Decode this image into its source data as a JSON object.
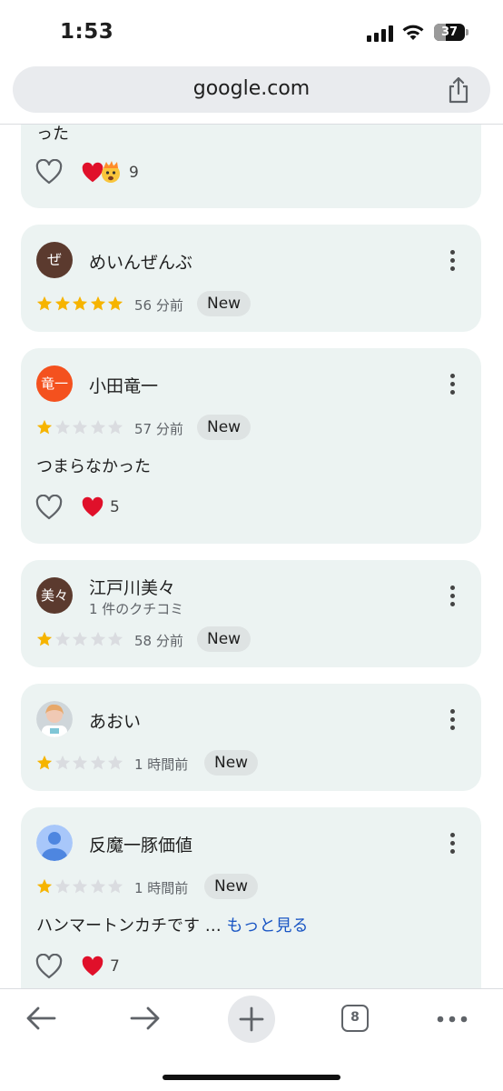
{
  "status": {
    "time": "1:53",
    "battery": "37",
    "battery_level": 0.37
  },
  "browser": {
    "url": "google.com",
    "tab_count": "8"
  },
  "reviews": [
    {
      "partial": true,
      "text": "った",
      "reaction_emojis": [
        "heart",
        "exploding-head"
      ],
      "reaction_count": "9"
    },
    {
      "avatar_text": "ぜ",
      "avatar_color": "#5b3a2e",
      "name": "めいんぜんぶ",
      "rating": 5,
      "age": "56 分前",
      "badge": "New"
    },
    {
      "avatar_text": "竜一",
      "avatar_color": "#f4511e",
      "name": "小田竜一",
      "rating": 1,
      "age": "57 分前",
      "badge": "New",
      "text": "つまらなかった",
      "reaction_count": "5"
    },
    {
      "avatar_text": "美々",
      "avatar_color": "#5b3a2e",
      "name": "江戸川美々",
      "subtext": "1 件のクチコミ",
      "rating": 1,
      "age": "58 分前",
      "badge": "New"
    },
    {
      "avatar_type": "photo",
      "name": "あおい",
      "rating": 1,
      "age": "1 時間前",
      "badge": "New"
    },
    {
      "avatar_type": "default-person",
      "name": "反魔一豚価値",
      "rating": 1,
      "age": "1 時間前",
      "badge": "New",
      "text": "ハンマートンカチです …",
      "more_label": "もっと見る",
      "reaction_count": "7"
    }
  ],
  "colors": {
    "star_filled": "#f6b400",
    "star_empty": "#dadce0",
    "link": "#1a56c4",
    "card_bg": "#ecf3f2"
  }
}
